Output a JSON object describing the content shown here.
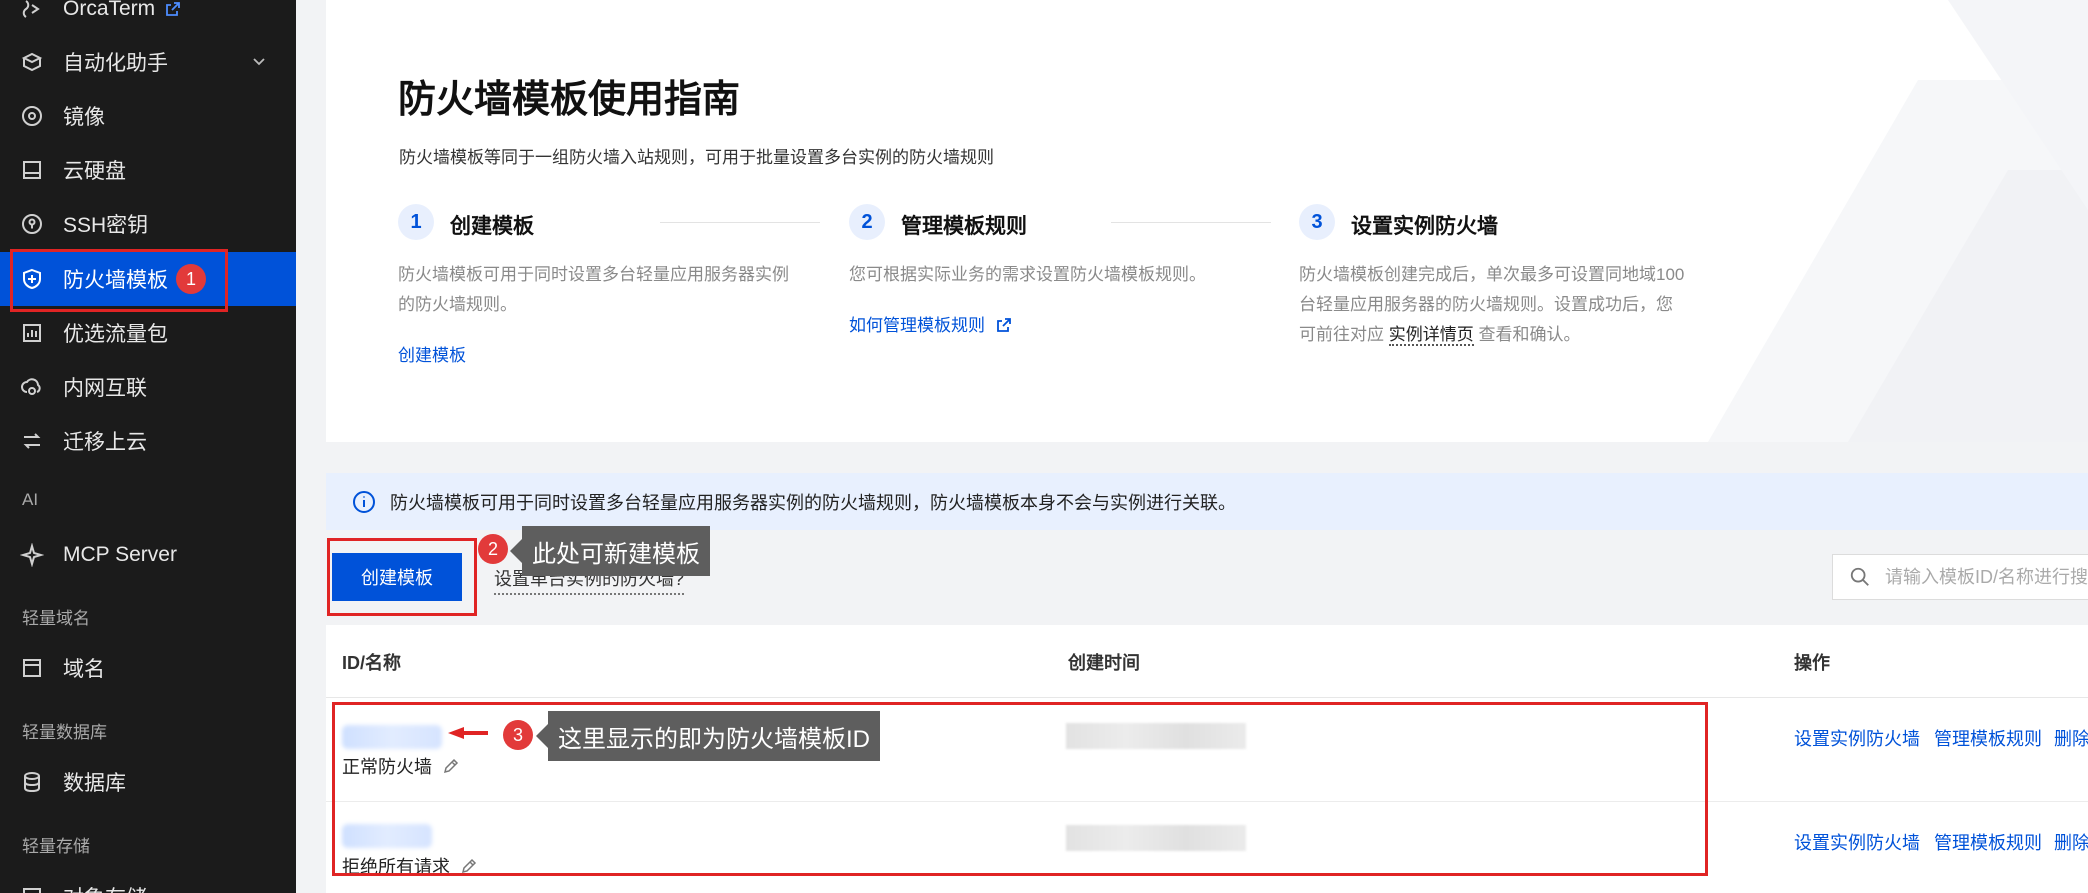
{
  "sidebar": {
    "items": [
      {
        "label": "OrcaTerm",
        "icon": "terminal-icon"
      },
      {
        "label": "自动化助手",
        "icon": "robot-icon"
      },
      {
        "label": "镜像",
        "icon": "disc-icon"
      },
      {
        "label": "云硬盘",
        "icon": "disk-icon"
      },
      {
        "label": "SSH密钥",
        "icon": "key-icon"
      },
      {
        "label": "防火墙模板",
        "icon": "shield-icon",
        "badge": "1"
      },
      {
        "label": "优选流量包",
        "icon": "chart-icon"
      },
      {
        "label": "内网互联",
        "icon": "network-icon"
      },
      {
        "label": "迁移上云",
        "icon": "migrate-icon"
      },
      {
        "label": "MCP Server",
        "icon": "sparkle-icon"
      },
      {
        "label": "域名",
        "icon": "domain-icon"
      },
      {
        "label": "数据库",
        "icon": "database-icon"
      },
      {
        "label": "对象存储",
        "icon": "storage-icon"
      }
    ],
    "sections": {
      "ai": "AI",
      "domain": "轻量域名",
      "database": "轻量数据库",
      "storage": "轻量存储"
    }
  },
  "guide": {
    "title": "防火墙模板使用指南",
    "description": "防火墙模板等同于一组防火墙入站规则，可用于批量设置多台实例的防火墙规则",
    "steps": [
      {
        "num": "1",
        "title": "创建模板",
        "desc": "防火墙模板可用于同时设置多台轻量应用服务器实例的防火墙规则。",
        "link": "创建模板"
      },
      {
        "num": "2",
        "title": "管理模板规则",
        "desc": "您可根据实际业务的需求设置防火墙模板规则。",
        "link": "如何管理模板规则"
      },
      {
        "num": "3",
        "title": "设置实例防火墙",
        "desc_pre": "防火墙模板创建完成后，单次最多可设置同地域100台轻量应用服务器的防火墙规则。设置成功后，您可前往对应",
        "desc_link": "实例详情页",
        "desc_post": "查看和确认。"
      }
    ]
  },
  "info": {
    "text": "防火墙模板可用于同时设置多台轻量应用服务器实例的防火墙规则，防火墙模板本身不会与实例进行关联。"
  },
  "toolbar": {
    "create_label": "创建模板",
    "single_link": "设置单台实例的防火墙?",
    "search_placeholder": "请输入模板ID/名称进行搜索"
  },
  "annotations": {
    "a2": {
      "num": "2",
      "text": "此处可新建模板"
    },
    "a3": {
      "num": "3",
      "text": "这里显示的即为防火墙模板ID"
    }
  },
  "table": {
    "columns": [
      "ID/名称",
      "创建时间",
      "操作"
    ],
    "rows": [
      {
        "name": "正常防火墙",
        "ops": [
          "设置实例防火墙",
          "管理模板规则",
          "删除"
        ]
      },
      {
        "name": "拒绝所有请求",
        "ops": [
          "设置实例防火墙",
          "管理模板规则",
          "删除"
        ]
      }
    ]
  }
}
